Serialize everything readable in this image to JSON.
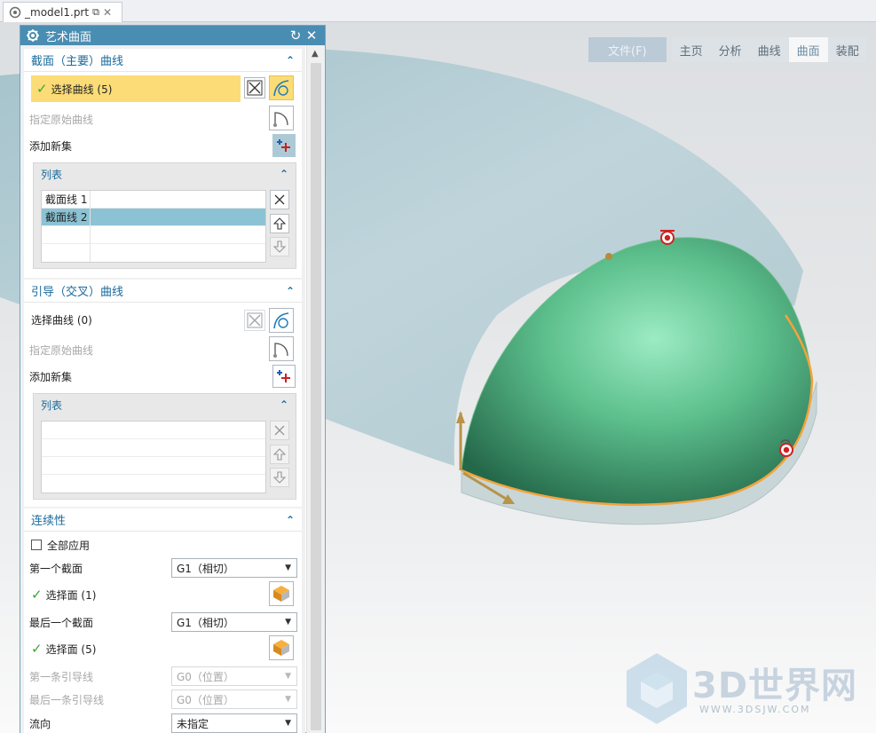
{
  "tab": {
    "filename": "_model1.prt"
  },
  "ribbon": {
    "tabs": [
      "文件(F)",
      "主页",
      "分析",
      "曲线",
      "曲面",
      "装配"
    ],
    "active": "曲面"
  },
  "dialog": {
    "title": "艺术曲面",
    "section_curves": {
      "title": "截面（主要）曲线",
      "select_label": "选择曲线 (5)",
      "origin_label": "指定原始曲线",
      "add_new_label": "添加新集",
      "list": {
        "title": "列表",
        "rows": [
          "截面线 1",
          "截面线 2"
        ],
        "selected": "截面线 2"
      }
    },
    "guide_curves": {
      "title": "引导（交叉）曲线",
      "select_label": "选择曲线 (0)",
      "origin_label": "指定原始曲线",
      "add_new_label": "添加新集",
      "list": {
        "title": "列表"
      }
    },
    "continuity": {
      "title": "连续性",
      "apply_all_label": "全部应用",
      "first_section_label": "第一个截面",
      "first_section_value": "G1（相切）",
      "first_face_label": "选择面 (1)",
      "last_section_label": "最后一个截面",
      "last_section_value": "G1（相切）",
      "last_face_label": "选择面 (5)",
      "first_guide_label": "第一条引导线",
      "first_guide_value": "G0（位置）",
      "last_guide_label": "最后一条引导线",
      "last_guide_value": "G0（位置）",
      "flow_label": "流向",
      "flow_value": "未指定"
    }
  },
  "watermark": {
    "brand": "3D世界网",
    "url": "WWW.3DSJW.COM"
  },
  "colors": {
    "accent": "#4a8db2",
    "highlight": "#fcdc76",
    "surface_green": "#4fae7e",
    "check_green": "#3aa43a"
  }
}
